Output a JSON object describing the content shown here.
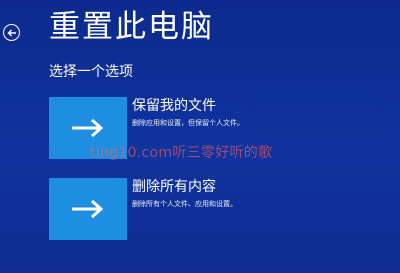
{
  "header": {
    "title": "重置此电脑",
    "back_icon": "back-arrow-circle-icon"
  },
  "subtitle": "选择一个选项",
  "options": [
    {
      "title": "保留我的文件",
      "description": "删除应用和设置，但保留个人文件。",
      "icon": "right-arrow-icon"
    },
    {
      "title": "删除所有内容",
      "description": "删除所有个人文件、应用和设置。",
      "icon": "right-arrow-icon"
    }
  ],
  "watermark": "ting10.com听三零好听的歌",
  "colors": {
    "background": "#10339f",
    "tile_accent": "#1e8ee0",
    "text": "#ffffff"
  }
}
